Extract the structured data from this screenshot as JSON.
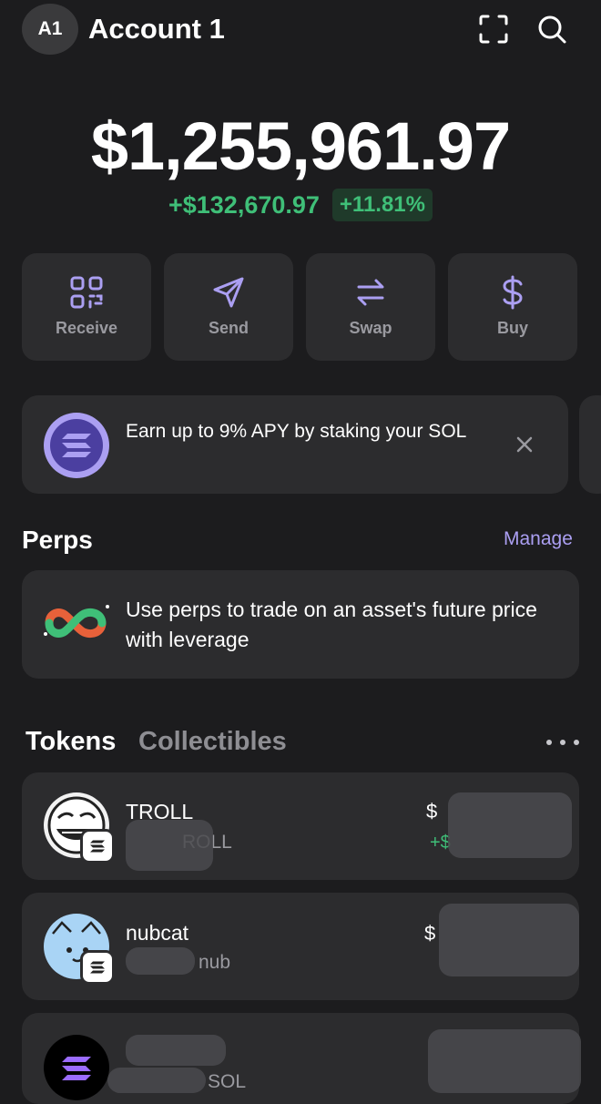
{
  "header": {
    "avatar_initials": "A1",
    "account_name": "Account 1",
    "icons": [
      "scan-icon",
      "search-icon"
    ]
  },
  "portfolio": {
    "balance": "$1,255,961.97",
    "change_amount": "+$132,670.97",
    "change_percent": "+11.81%",
    "positive_color": "#3fbf78"
  },
  "actions": [
    {
      "label": "Receive",
      "icon": "qr-code-icon"
    },
    {
      "label": "Send",
      "icon": "paper-plane-icon"
    },
    {
      "label": "Swap",
      "icon": "swap-arrows-icon"
    },
    {
      "label": "Buy",
      "icon": "dollar-icon"
    }
  ],
  "banner": {
    "text": "Earn up to 9% APY by staking your SOL",
    "icon": "solana-logo-icon"
  },
  "perps": {
    "title": "Perps",
    "manage_label": "Manage",
    "description": "Use perps to trade on an asset's future price with leverage",
    "icon": "perps-infinity-icon"
  },
  "tabs": {
    "tokens": "Tokens",
    "collectibles": "Collectibles"
  },
  "tokens": [
    {
      "name": "TROLL",
      "sub_partial": "ROLL",
      "value_partial": "$",
      "change_partial": "+$",
      "icon": "troll-face-icon"
    },
    {
      "name": "nubcat",
      "sub_partial": "nub",
      "value_partial": "$",
      "icon": "nubcat-icon"
    },
    {
      "name": "",
      "sub_partial": "SOL",
      "value_partial": "",
      "icon": "solana-logo-icon"
    }
  ],
  "accent_color": "#ab9ff2"
}
